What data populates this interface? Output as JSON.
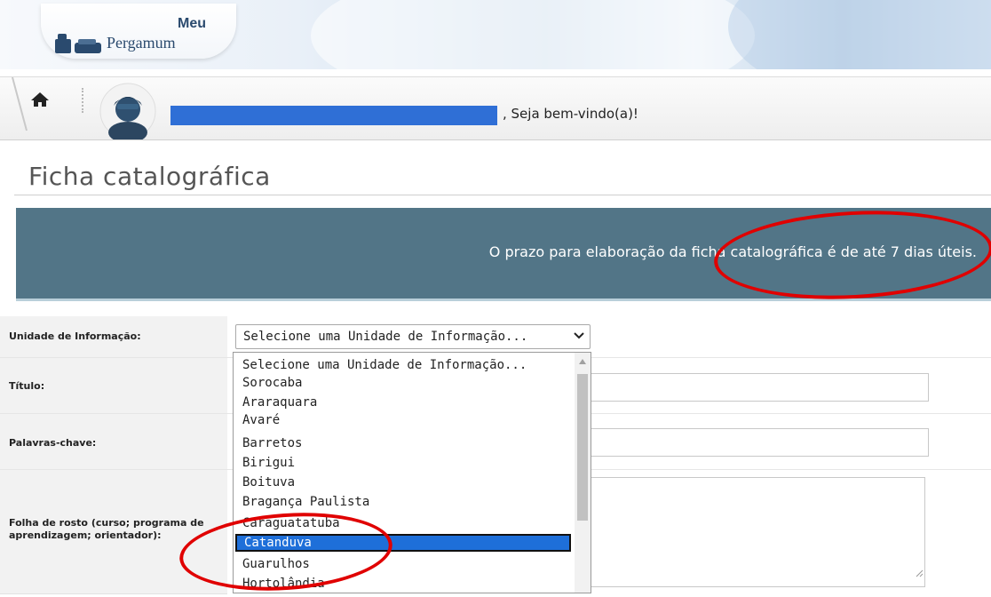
{
  "header": {
    "logo_meu": "Meu",
    "logo_name": "Pergamum"
  },
  "welcome": {
    "greeting": ", Seja bem-vindo(a)!"
  },
  "page": {
    "title": "Ficha catalográfica"
  },
  "notice": {
    "text": "O prazo para elaboração da ficha catalográfica é de até 7 dias úteis."
  },
  "form": {
    "unidade_label": "Unidade de Informação:",
    "titulo_label": "Título:",
    "palavras_label": "Palavras-chave:",
    "folha_label": "Folha de rosto (curso; programa de aprendizagem; orientador):",
    "select_value": "Selecione uma Unidade de Informação...",
    "options": [
      "Selecione uma Unidade de Informação...",
      "Sorocaba",
      "Araraquara",
      "Avaré",
      "Barretos",
      "Birigui",
      "Boituva",
      "Bragança Paulista",
      "Caraguatatuba",
      "Catanduva",
      "Guarulhos",
      "Hortolândia"
    ],
    "selected_option": "Catanduva"
  },
  "colors": {
    "notice_bg": "#527587",
    "highlight": "#1e6fd9",
    "annotation": "#e00000"
  }
}
